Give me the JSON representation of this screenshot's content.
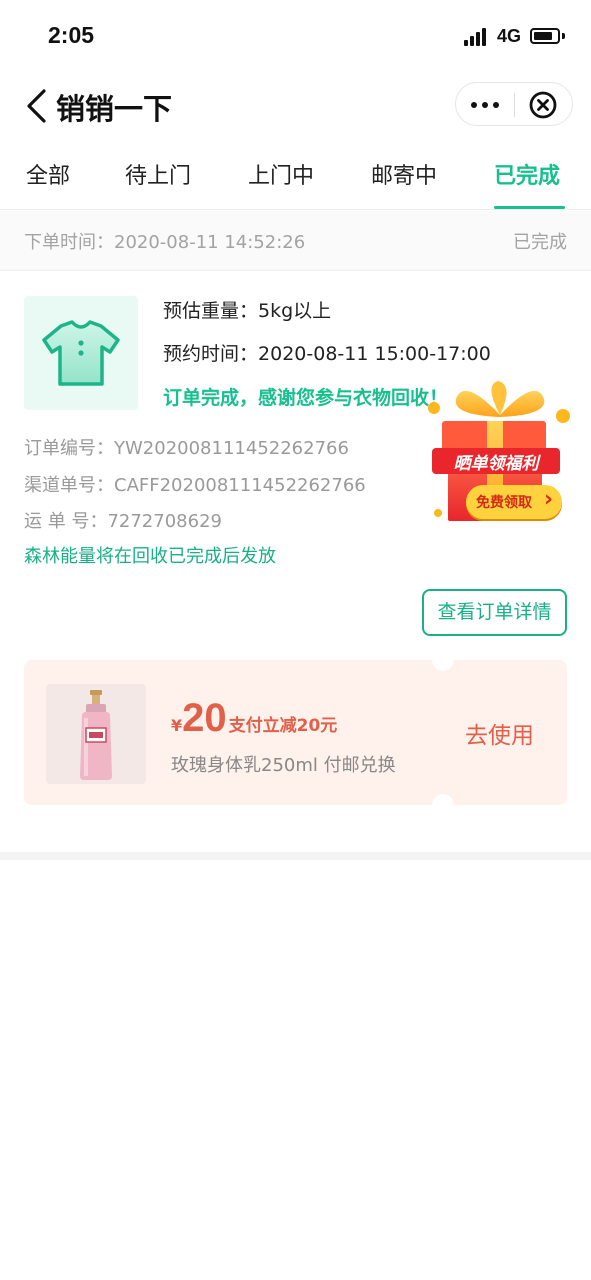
{
  "status_bar": {
    "time": "2:05",
    "network": "4G"
  },
  "nav": {
    "title": "销销一下"
  },
  "tabs": [
    {
      "label": "全部",
      "active": false
    },
    {
      "label": "待上门",
      "active": false
    },
    {
      "label": "上门中",
      "active": false
    },
    {
      "label": "邮寄中",
      "active": false
    },
    {
      "label": "已完成",
      "active": true
    }
  ],
  "order": {
    "time_label": "下单时间：",
    "time_value": "2020-08-11 14:52:26",
    "status": "已完成",
    "weight_label": "预估重量：",
    "weight_value": "5kg以上",
    "appt_label": "预约时间：",
    "appt_value": "2020-08-11 15:00-17:00",
    "done_message": "订单完成，感谢您参与衣物回收！",
    "order_no_label": "订单编号：",
    "order_no": "YW202008111452262766",
    "channel_no_label": "渠道单号：",
    "channel_no": "CAFF202008111452262766",
    "waybill_label": "运 单 号：",
    "waybill_no": "7272708629",
    "energy_note": "森林能量将在回收已完成后发放",
    "detail_button": "查看订单详情"
  },
  "promo": {
    "gift_title": "晒单领福利",
    "gift_button": "免费领取",
    "gift_arrow": "›"
  },
  "coupon": {
    "currency": "¥",
    "amount": "20",
    "desc": "支付立减20元",
    "subtitle": "玫瑰身体乳250ml 付邮兑换",
    "use_label": "去使用"
  },
  "colors": {
    "accent": "#18c08f",
    "coupon": "#e0604a",
    "coupon_bg": "#fff1ec"
  }
}
